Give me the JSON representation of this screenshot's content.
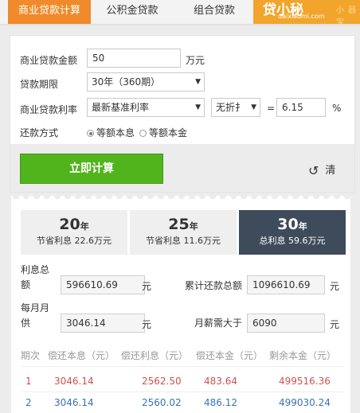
{
  "tabs": [
    {
      "label": "商业贷款计算"
    },
    {
      "label": "公积金贷款"
    },
    {
      "label": "组合贷款"
    }
  ],
  "logo": {
    "main": "贷小秘",
    "sub": "daixiaomi.com",
    "ghost": "小 器 宝"
  },
  "form": {
    "amount_label": "商业贷款金额",
    "amount_value": "50",
    "amount_unit": "万元",
    "term_label": "贷款期限",
    "term_value": "30年（360期）",
    "rate_label": "商业贷款利率",
    "rate_select": "最新基准利率",
    "discount_select": "无折扌",
    "equals": "=",
    "rate_value": "6.15",
    "rate_unit": "%",
    "method_label": "还款方式",
    "method_option1": "等额本息",
    "method_option2": "等额本金",
    "calc_button": "立即计算",
    "reset_label": "清"
  },
  "result": {
    "pills": [
      {
        "years": "20",
        "unit": "年",
        "text": "节省利息 22.6万元"
      },
      {
        "years": "25",
        "unit": "年",
        "text": "节省利息 11.6万元"
      },
      {
        "years": "30",
        "unit": "年",
        "text": "总利息 59.6万元"
      }
    ],
    "total_interest_label": "利息总额",
    "total_interest_value": "596610.69",
    "total_interest_unit": "元",
    "total_repay_label": "累计还款总额",
    "total_repay_value": "1096610.69",
    "total_repay_unit": "元",
    "monthly_label": "每月月供",
    "monthly_value": "3046.14",
    "monthly_unit": "元",
    "salary_label": "月薪需大于",
    "salary_value": "6090",
    "salary_unit": "元"
  },
  "table": {
    "headers": [
      "期次",
      "偿还本息（元）",
      "偿还利息（元）",
      "偿还本金（元）",
      "剩余本金（元）"
    ],
    "rows": [
      [
        "1",
        "3046.14",
        "2562.50",
        "483.64",
        "499516.36"
      ],
      [
        "2",
        "3046.14",
        "2560.02",
        "486.12",
        "499030.24"
      ]
    ]
  },
  "colors": {
    "accent": "#f08a2a",
    "calc_button": "#52b41d",
    "dark_pill": "#3e4b5b",
    "row_red": "#d05050",
    "row_blue": "#3a72b8"
  }
}
